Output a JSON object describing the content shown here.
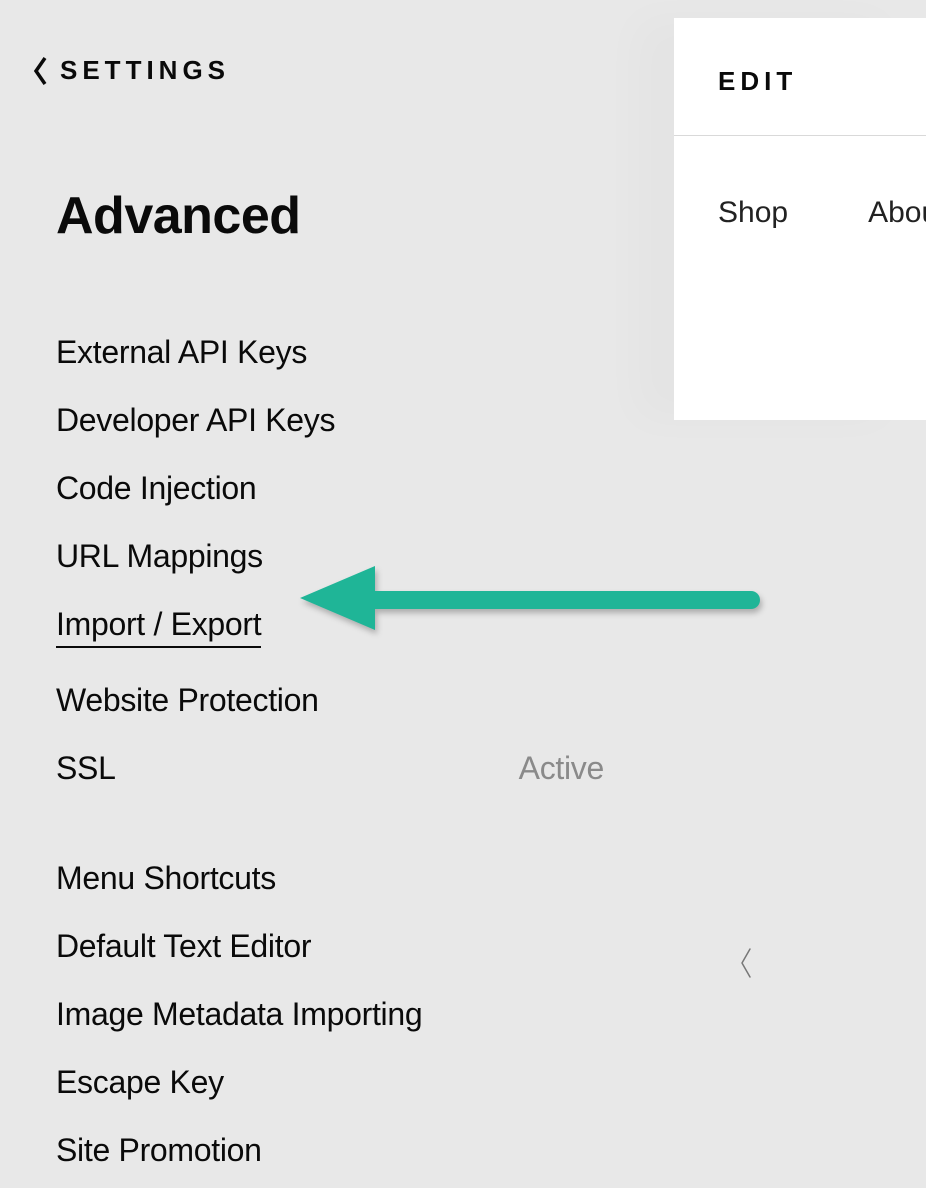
{
  "back": {
    "label": "SETTINGS"
  },
  "title": "Advanced",
  "group1": {
    "items": {
      "0": {
        "label": "External API Keys"
      },
      "1": {
        "label": "Developer API Keys"
      },
      "2": {
        "label": "Code Injection"
      },
      "3": {
        "label": "URL Mappings"
      },
      "4": {
        "label": "Import / Export"
      },
      "5": {
        "label": "Website Protection"
      },
      "6": {
        "label": "SSL",
        "status": "Active"
      }
    }
  },
  "group2": {
    "items": {
      "0": {
        "label": "Menu Shortcuts"
      },
      "1": {
        "label": "Default Text Editor"
      },
      "2": {
        "label": "Image Metadata Importing"
      },
      "3": {
        "label": "Escape Key"
      },
      "4": {
        "label": "Site Promotion"
      }
    }
  },
  "preview": {
    "edit": "EDIT",
    "nav": {
      "0": "Shop",
      "1": "About"
    }
  },
  "annotation": {
    "color": "#1fb597"
  }
}
